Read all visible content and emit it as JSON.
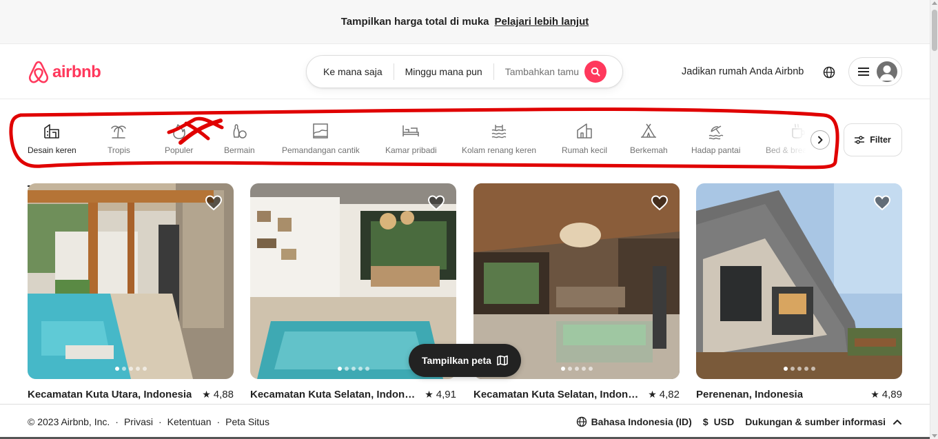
{
  "banner": {
    "message": "Tampilkan harga total di muka",
    "link": "Pelajari lebih lanjut"
  },
  "header": {
    "logo_text": "airbnb",
    "search": {
      "where": "Ke mana saja",
      "when": "Minggu mana pun",
      "guests_placeholder": "Tambahkan tamu"
    },
    "host_link": "Jadikan rumah Anda Airbnb"
  },
  "categories": {
    "items": [
      {
        "label": "Desain keren",
        "icon": "house-design-icon",
        "active": true
      },
      {
        "label": "Tropis",
        "icon": "palm-tree-icon"
      },
      {
        "label": "Populer",
        "icon": "flame-icon"
      },
      {
        "label": "Bermain",
        "icon": "bowling-icon"
      },
      {
        "label": "Pemandangan cantik",
        "icon": "framed-landscape-icon"
      },
      {
        "label": "Kamar pribadi",
        "icon": "bed-icon"
      },
      {
        "label": "Kolam renang keren",
        "icon": "pool-icon"
      },
      {
        "label": "Rumah kecil",
        "icon": "small-house-icon"
      },
      {
        "label": "Berkemah",
        "icon": "tent-icon"
      },
      {
        "label": "Hadap pantai",
        "icon": "beach-icon"
      },
      {
        "label": "Bed & breakfast",
        "icon": "coffee-cup-icon"
      }
    ],
    "filter_label": "Filter"
  },
  "listings": [
    {
      "location": "Kecamatan Kuta Utara, Indonesia",
      "rating": "4,88"
    },
    {
      "location": "Kecamatan Kuta Selatan, Indonesia",
      "rating": "4,91"
    },
    {
      "location": "Kecamatan Kuta Selatan, Indonesia",
      "rating": "4,82"
    },
    {
      "location": "Perenenan, Indonesia",
      "rating": "4,89"
    }
  ],
  "map_button": "Tampilkan peta",
  "footer": {
    "copyright": "© 2023 Airbnb, Inc.",
    "links": [
      "Privasi",
      "Ketentuan",
      "Peta Situs"
    ],
    "language": "Bahasa Indonesia (ID)",
    "currency_symbol": "$",
    "currency": "USD",
    "support": "Dukungan & sumber informasi"
  },
  "colors": {
    "brand": "#ff385c",
    "text": "#222222",
    "muted": "#717171",
    "annotation": "#e00000"
  }
}
